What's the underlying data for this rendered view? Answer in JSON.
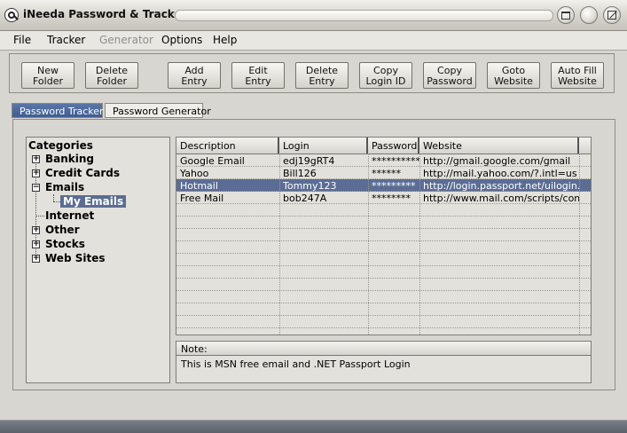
{
  "window": {
    "title": "iNeeda Password & Tracker Pro"
  },
  "menu": {
    "items": [
      {
        "label": "File",
        "disabled": false
      },
      {
        "label": "Tracker",
        "disabled": false
      },
      {
        "label": "Generator",
        "disabled": true
      },
      {
        "label": "Options",
        "disabled": false
      },
      {
        "label": "Help",
        "disabled": false
      }
    ]
  },
  "toolbar": {
    "buttons": [
      {
        "label": "New\nFolder"
      },
      {
        "label": "Delete\nFolder"
      },
      {
        "label": "Add\nEntry"
      },
      {
        "label": "Edit\nEntry"
      },
      {
        "label": "Delete\nEntry"
      },
      {
        "label": "Copy\nLogin ID"
      },
      {
        "label": "Copy\nPassword"
      },
      {
        "label": "Goto\nWebsite"
      },
      {
        "label": "Auto Fill\nWebsite"
      }
    ]
  },
  "tabs": [
    {
      "label": "Password Tracker",
      "active": true
    },
    {
      "label": "Password Generator",
      "active": false
    }
  ],
  "tree": {
    "root": "Categories",
    "items": [
      {
        "label": "Banking",
        "expander": "+"
      },
      {
        "label": "Credit Cards",
        "expander": "+"
      },
      {
        "label": "Emails",
        "expander": "−"
      },
      {
        "label": "My Emails",
        "expander": ""
      },
      {
        "label": "Internet",
        "expander": ""
      },
      {
        "label": "Other",
        "expander": "+"
      },
      {
        "label": "Stocks",
        "expander": "+"
      },
      {
        "label": "Web Sites",
        "expander": "+"
      }
    ]
  },
  "grid": {
    "columns": [
      "Description",
      "Login",
      "Password",
      "Website"
    ],
    "rows": [
      {
        "description": "Google Email",
        "login": "edj19gRT4",
        "password": "**********",
        "website": "http://gmail.google.com/gmail"
      },
      {
        "description": "Yahoo",
        "login": "Bill126",
        "password": "******",
        "website": "http://mail.yahoo.com/?.intl=us"
      },
      {
        "description": "Hotmail",
        "login": "Tommy123",
        "password": "*********",
        "website": "http://login.passport.net/uilogin.sr..."
      },
      {
        "description": "Free Mail",
        "login": "bob247A",
        "password": "********",
        "website": "http://www.mail.com/scripts/com..."
      }
    ],
    "selected_row": 2
  },
  "note": {
    "title": "Note:",
    "text": "This is MSN free email and .NET Passport Login"
  }
}
